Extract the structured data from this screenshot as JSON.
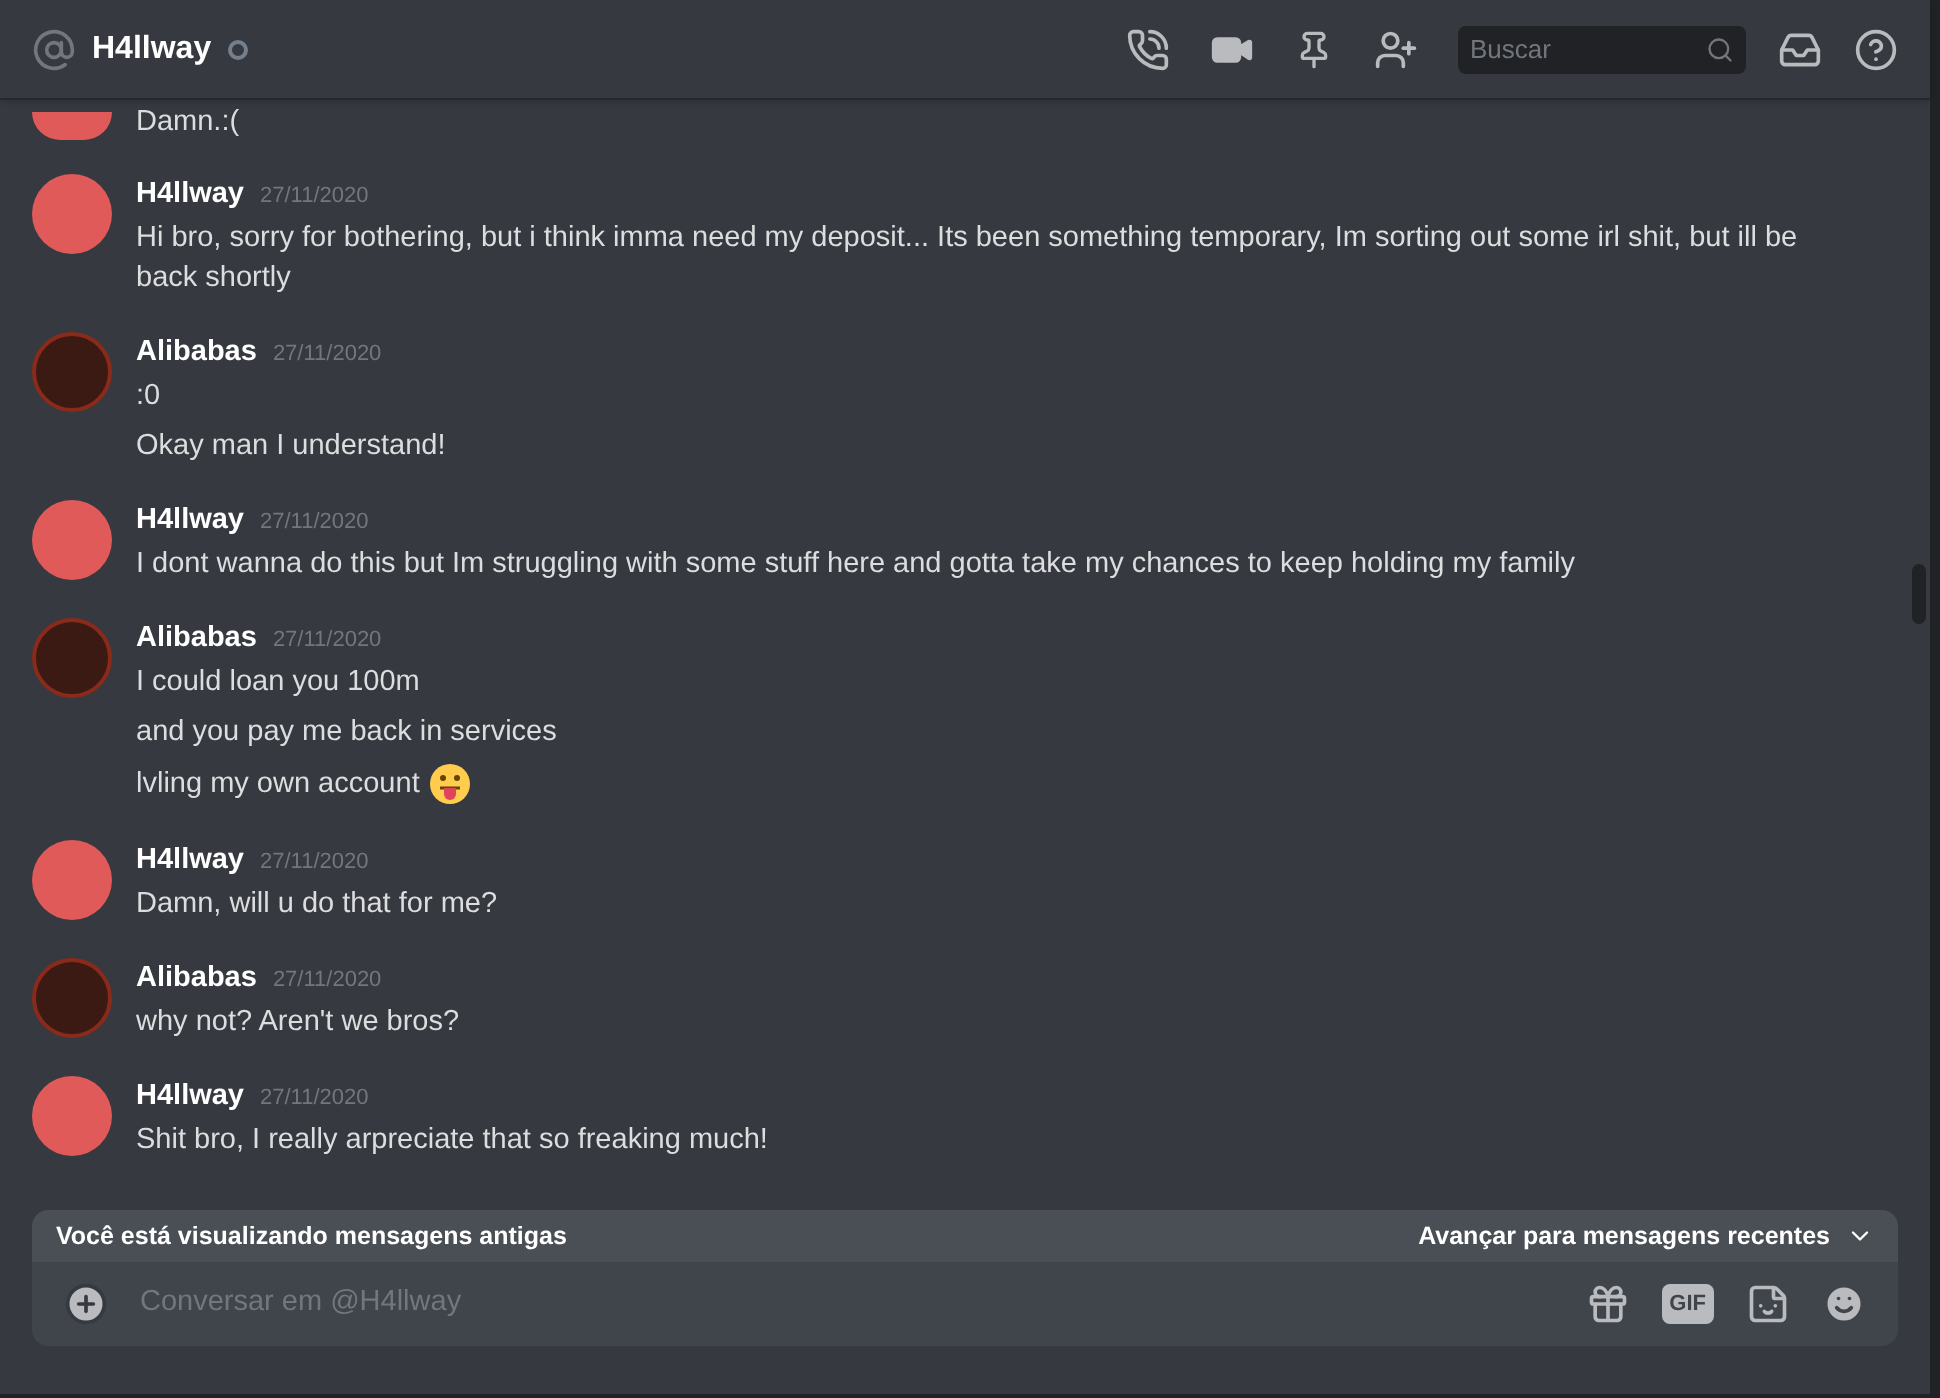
{
  "header": {
    "title": "H4llway",
    "search": {
      "placeholder": "Buscar"
    }
  },
  "partial_message": "Damn.:(",
  "messages": [
    {
      "author": "H4llway",
      "kind": "red",
      "time": "27/11/2020",
      "lines": [
        {
          "text": "Hi bro, sorry for bothering, but i think imma need my deposit... Its been something temporary, Im sorting out some irl shit, but ill be back shortly",
          "emoji": false
        }
      ]
    },
    {
      "author": "Alibabas",
      "kind": "dark",
      "time": "27/11/2020",
      "lines": [
        {
          "text": ":0",
          "emoji": false
        },
        {
          "text": "Okay man I understand!",
          "emoji": false
        }
      ]
    },
    {
      "author": "H4llway",
      "kind": "red",
      "time": "27/11/2020",
      "lines": [
        {
          "text": "I dont wanna do this but Im struggling with some stuff here and gotta take my chances to keep holding my family",
          "emoji": false
        }
      ]
    },
    {
      "author": "Alibabas",
      "kind": "dark",
      "time": "27/11/2020",
      "lines": [
        {
          "text": "I could loan you 100m",
          "emoji": false
        },
        {
          "text": "and you pay me back in services",
          "emoji": false
        },
        {
          "text": "lvling my own account",
          "emoji": true
        }
      ]
    },
    {
      "author": "H4llway",
      "kind": "red",
      "time": "27/11/2020",
      "lines": [
        {
          "text": "Damn, will u do that for me?",
          "emoji": false
        }
      ]
    },
    {
      "author": "Alibabas",
      "kind": "dark",
      "time": "27/11/2020",
      "lines": [
        {
          "text": "why not? Aren't we bros?",
          "emoji": false
        }
      ]
    },
    {
      "author": "H4llway",
      "kind": "red",
      "time": "27/11/2020",
      "lines": [
        {
          "text": "Shit bro, I really arpreciate that so freaking much!",
          "emoji": false
        }
      ]
    }
  ],
  "old_messages_bar": {
    "notice": "Você está visualizando mensagens antigas",
    "jump": "Avançar para mensagens recentes"
  },
  "composer": {
    "placeholder": "Conversar em @H4llway",
    "gif": "GIF"
  }
}
